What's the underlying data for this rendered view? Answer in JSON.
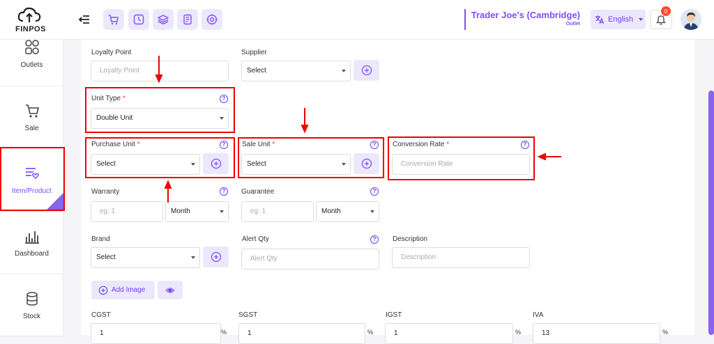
{
  "app": {
    "logo_text": "FINPOS"
  },
  "header": {
    "store_name": "Trader Joe's (Cambridge)",
    "store_sub": "Outlet",
    "language": "English",
    "notification_count": "0"
  },
  "sidebar": {
    "items": [
      {
        "label": "Outlets",
        "icon": "outlets-icon"
      },
      {
        "label": "Sale",
        "icon": "cart-icon"
      },
      {
        "label": "Item/Product",
        "icon": "product-icon"
      },
      {
        "label": "Dashboard",
        "icon": "dashboard-icon"
      },
      {
        "label": "Stock",
        "icon": "stock-icon"
      }
    ]
  },
  "form": {
    "loyalty_point": {
      "label": "Loyalty Point",
      "placeholder": "Loyalty Point"
    },
    "supplier": {
      "label": "Supplier",
      "value": "Select"
    },
    "unit_type": {
      "label": "Unit Type",
      "req": "*",
      "value": "Double Unit"
    },
    "purchase_unit": {
      "label": "Purchase Unit",
      "req": "*",
      "value": "Select"
    },
    "sale_unit": {
      "label": "Sale Unit",
      "req": "*",
      "value": "Select"
    },
    "conversion_rate": {
      "label": "Conversion Rate",
      "req": "*",
      "placeholder": "Conversion Rate"
    },
    "warranty": {
      "label": "Warranty",
      "placeholder": "eg: 1",
      "period": "Month"
    },
    "guarantee": {
      "label": "Guarantee",
      "placeholder": "eg: 1",
      "period": "Month"
    },
    "brand": {
      "label": "Brand",
      "value": "Select"
    },
    "alert_qty": {
      "label": "Alert Qty",
      "placeholder": "Alert Qty"
    },
    "description": {
      "label": "Description",
      "placeholder": "Description"
    },
    "add_image": "Add Image",
    "taxes": [
      {
        "label": "CGST",
        "value": "1",
        "unit": "%"
      },
      {
        "label": "SGST",
        "value": "1",
        "unit": "%"
      },
      {
        "label": "IGST",
        "value": "1",
        "unit": "%"
      },
      {
        "label": "IVA",
        "value": "13",
        "unit": "%"
      }
    ]
  },
  "colors": {
    "accent": "#7c4dff",
    "highlight": "#e00000"
  }
}
